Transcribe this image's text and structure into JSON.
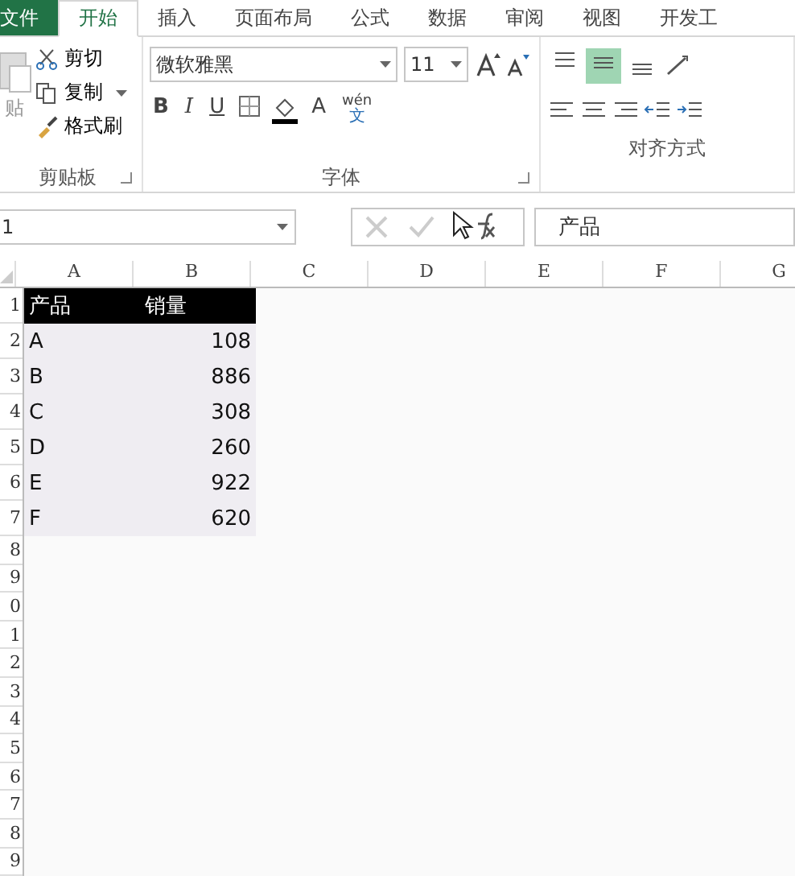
{
  "tabs": [
    {
      "label": "文件",
      "kind": "file",
      "selected": false
    },
    {
      "label": "开始",
      "kind": "tab",
      "selected": true
    },
    {
      "label": "插入",
      "kind": "tab",
      "selected": false
    },
    {
      "label": "页面布局",
      "kind": "tab",
      "selected": false
    },
    {
      "label": "公式",
      "kind": "tab",
      "selected": false
    },
    {
      "label": "数据",
      "kind": "tab",
      "selected": false
    },
    {
      "label": "审阅",
      "kind": "tab",
      "selected": false
    },
    {
      "label": "视图",
      "kind": "tab",
      "selected": false
    },
    {
      "label": "开发工",
      "kind": "tab",
      "selected": false
    }
  ],
  "clipboard": {
    "paste": "贴",
    "cut": "剪切",
    "copy": "复制",
    "format_painter": "格式刷",
    "label": "剪贴板"
  },
  "font": {
    "name": "微软雅黑",
    "size": "11",
    "bold": "B",
    "italic": "I",
    "underline": "U",
    "font_color": "A",
    "phonetic": "wén",
    "phonetic_char": "文",
    "label": "字体"
  },
  "alignment": {
    "vertical": [
      {
        "kind": "top",
        "selected": false
      },
      {
        "kind": "middle",
        "selected": true
      },
      {
        "kind": "bottom",
        "selected": false
      }
    ],
    "label": "对齐方式"
  },
  "name_box": "1",
  "formula": "产品",
  "columns": [
    "A",
    "B",
    "C",
    "D",
    "E",
    "F",
    "G"
  ],
  "row_headers": [
    "1",
    "2",
    "3",
    "4",
    "5",
    "6",
    "7",
    "8",
    "9",
    "0",
    "1",
    "2",
    "3",
    "4",
    "5",
    "6",
    "7",
    "8",
    "9"
  ],
  "table": {
    "header": [
      "产品",
      "销量"
    ],
    "rows": [
      [
        "A",
        "108"
      ],
      [
        "B",
        "886"
      ],
      [
        "C",
        "308"
      ],
      [
        "D",
        "260"
      ],
      [
        "E",
        "922"
      ],
      [
        "F",
        "620"
      ]
    ]
  }
}
